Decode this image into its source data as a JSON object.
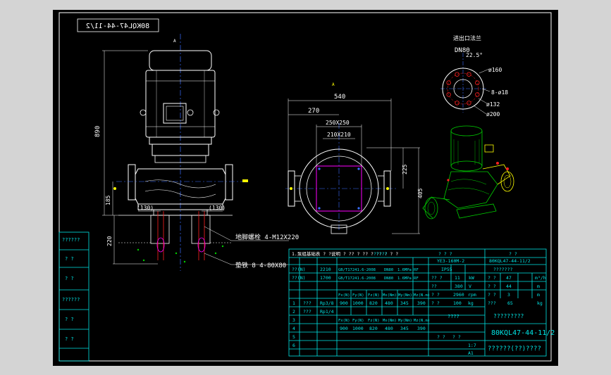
{
  "drawing_no_mirrored": "80KQL47-44-11/2",
  "front_view": {
    "section_mark": "A",
    "dim_height": "890",
    "dim_outlet_height": "185",
    "dim_left_130": "(130)",
    "dim_right_130": "(130)",
    "dim_base_height": "220"
  },
  "side_view": {
    "view_label": "A",
    "dim_total_width": "540",
    "dim_left_width": "270",
    "dim_250": "250X250",
    "dim_210": "210X210",
    "dim_225": "225",
    "dim_405": "405"
  },
  "flange_view": {
    "title": "进出口法兰",
    "dn": "DN80",
    "angle": "22.5°",
    "d160": "ø160",
    "holes": "8-ø18",
    "d132": "ø132",
    "d200": "ø200"
  },
  "callouts": {
    "anchor_bolt": "地脚螺栓 4-M12X220",
    "pad_iron": "垫铁 8 4-80X80"
  },
  "left_strip": [
    "??????",
    "? ?",
    "? ?",
    "??????",
    "? ?",
    "? ?"
  ],
  "table_header_note": "1.泵组基础表 ? ?说明 ? ?? ?  ?? ? ??  ?  ? ?",
  "title_block": {
    "drawing_no": "80KQL47-44-11/2",
    "name": "??????(??)????",
    "sub_title": "?????????",
    "mid_label": "????",
    "bottom_row": [
      "? ?",
      "? ?",
      "1:7"
    ],
    "sheet": "A1"
  },
  "spec_table": {
    "header": [
      "?????",
      "? ? ?",
      "? ?"
    ],
    "rows": [
      [
        "??(N)",
        "2210",
        "GB/T17241.6-2008",
        "DN80",
        "1.6MPa RF",
        "YE3-160M-2",
        "80KQL47-44-11/2"
      ],
      [
        "??(N)",
        "1700",
        "GB/T17241.6-2008",
        "DN80",
        "1.6MPa RF",
        "IP55",
        "???????"
      ],
      [
        "?? ?",
        "11",
        "kW",
        "? ?",
        "47",
        "m³/h"
      ],
      [
        "??",
        "380",
        "V",
        "? ?",
        "44",
        "m"
      ],
      [
        "? ?",
        "2960",
        "rpm",
        "? ?",
        "3",
        "m"
      ],
      [
        "? ?",
        "100",
        "kg",
        "???",
        "65",
        "kg"
      ]
    ],
    "load_headers": [
      "Fx(N)",
      "Fy(N)",
      "Fz(N)",
      "Mx(Nm)",
      "My(Nm)",
      "Mz(N.m)"
    ],
    "load_values": [
      "900",
      "1000",
      "820",
      "480",
      "345",
      "390"
    ],
    "row_labels": [
      "1",
      "2",
      "3",
      "4",
      "5",
      "6"
    ],
    "row_items": [
      "???",
      "???",
      "",
      "",
      "",
      ""
    ],
    "row_codes": [
      "Rp3/8",
      "Rp1/4",
      "",
      "",
      "",
      ""
    ]
  },
  "colors": {
    "background": "#000000",
    "border": "#ffffff",
    "table": "#00e5e5",
    "geometry": "#ffffff",
    "centerline": "#3a6cff",
    "accent_magenta": "#ff00ff",
    "accent_red": "#ff2020",
    "accent_yellow": "#ffff00",
    "accent_green": "#00d000"
  }
}
